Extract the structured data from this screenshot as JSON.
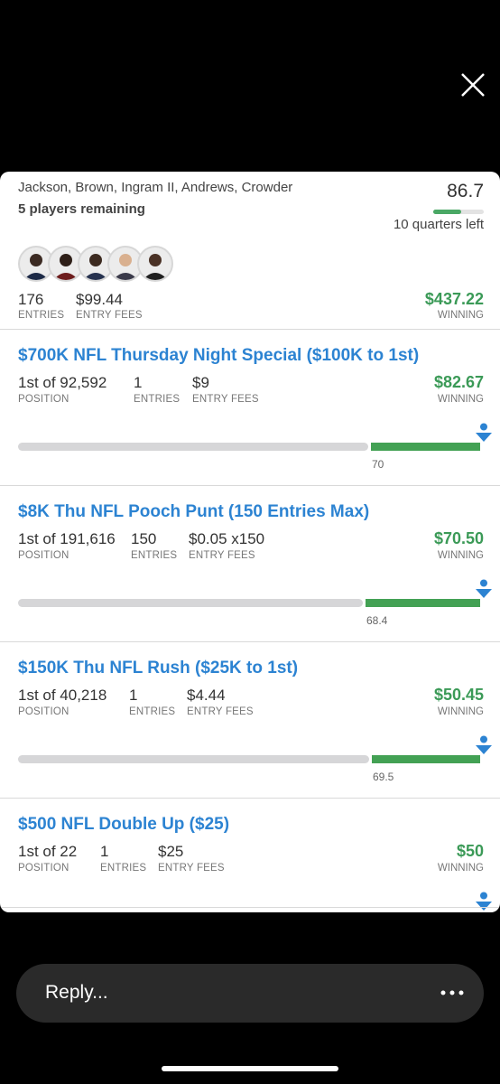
{
  "summary": {
    "players": "Jackson, Brown, Ingram II, Andrews, Crowder",
    "remaining": "5 players remaining",
    "score": "86.7",
    "score_progress": 0.55,
    "quarters": "10 quarters left",
    "entries_val": "176",
    "entries_lbl": "ENTRIES",
    "fees_val": "$99.44",
    "fees_lbl": "ENTRY FEES",
    "win_val": "$437.22",
    "win_lbl": "WINNING"
  },
  "contests": [
    {
      "title": "$700K NFL Thursday Night Special ($100K to 1st)",
      "position": "1st of 92,592",
      "position_lbl": "POSITION",
      "entries": "1",
      "entries_lbl": "ENTRIES",
      "fees": "$9",
      "fees_lbl": "ENTRY FEES",
      "winning": "$82.67",
      "winning_lbl": "WINNING",
      "cutoff": "70"
    },
    {
      "title": "$8K Thu NFL Pooch Punt (150 Entries Max)",
      "position": "1st of 191,616",
      "position_lbl": "POSITION",
      "entries": "150",
      "entries_lbl": "ENTRIES",
      "fees": "$0.05 x150",
      "fees_lbl": "ENTRY FEES",
      "winning": "$70.50",
      "winning_lbl": "WINNING",
      "cutoff": "68.4"
    },
    {
      "title": "$150K Thu NFL Rush ($25K to 1st)",
      "position": "1st of 40,218",
      "position_lbl": "POSITION",
      "entries": "1",
      "entries_lbl": "ENTRIES",
      "fees": "$4.44",
      "fees_lbl": "ENTRY FEES",
      "winning": "$50.45",
      "winning_lbl": "WINNING",
      "cutoff": "69.5"
    },
    {
      "title": "$500 NFL Double Up ($25)",
      "position": "1st of 22",
      "position_lbl": "POSITION",
      "entries": "1",
      "entries_lbl": "ENTRIES",
      "fees": "$25",
      "fees_lbl": "ENTRY FEES",
      "winning": "$50",
      "winning_lbl": "WINNING"
    }
  ],
  "reply": {
    "placeholder": "Reply..."
  },
  "icons": {
    "close": "close-icon",
    "more": "more-icon",
    "pin": "user-pin-icon"
  },
  "colors": {
    "link": "#2c83d2",
    "green": "#3b9a57",
    "bar_green": "#43a154",
    "bar_grey": "#d6d6d8"
  }
}
